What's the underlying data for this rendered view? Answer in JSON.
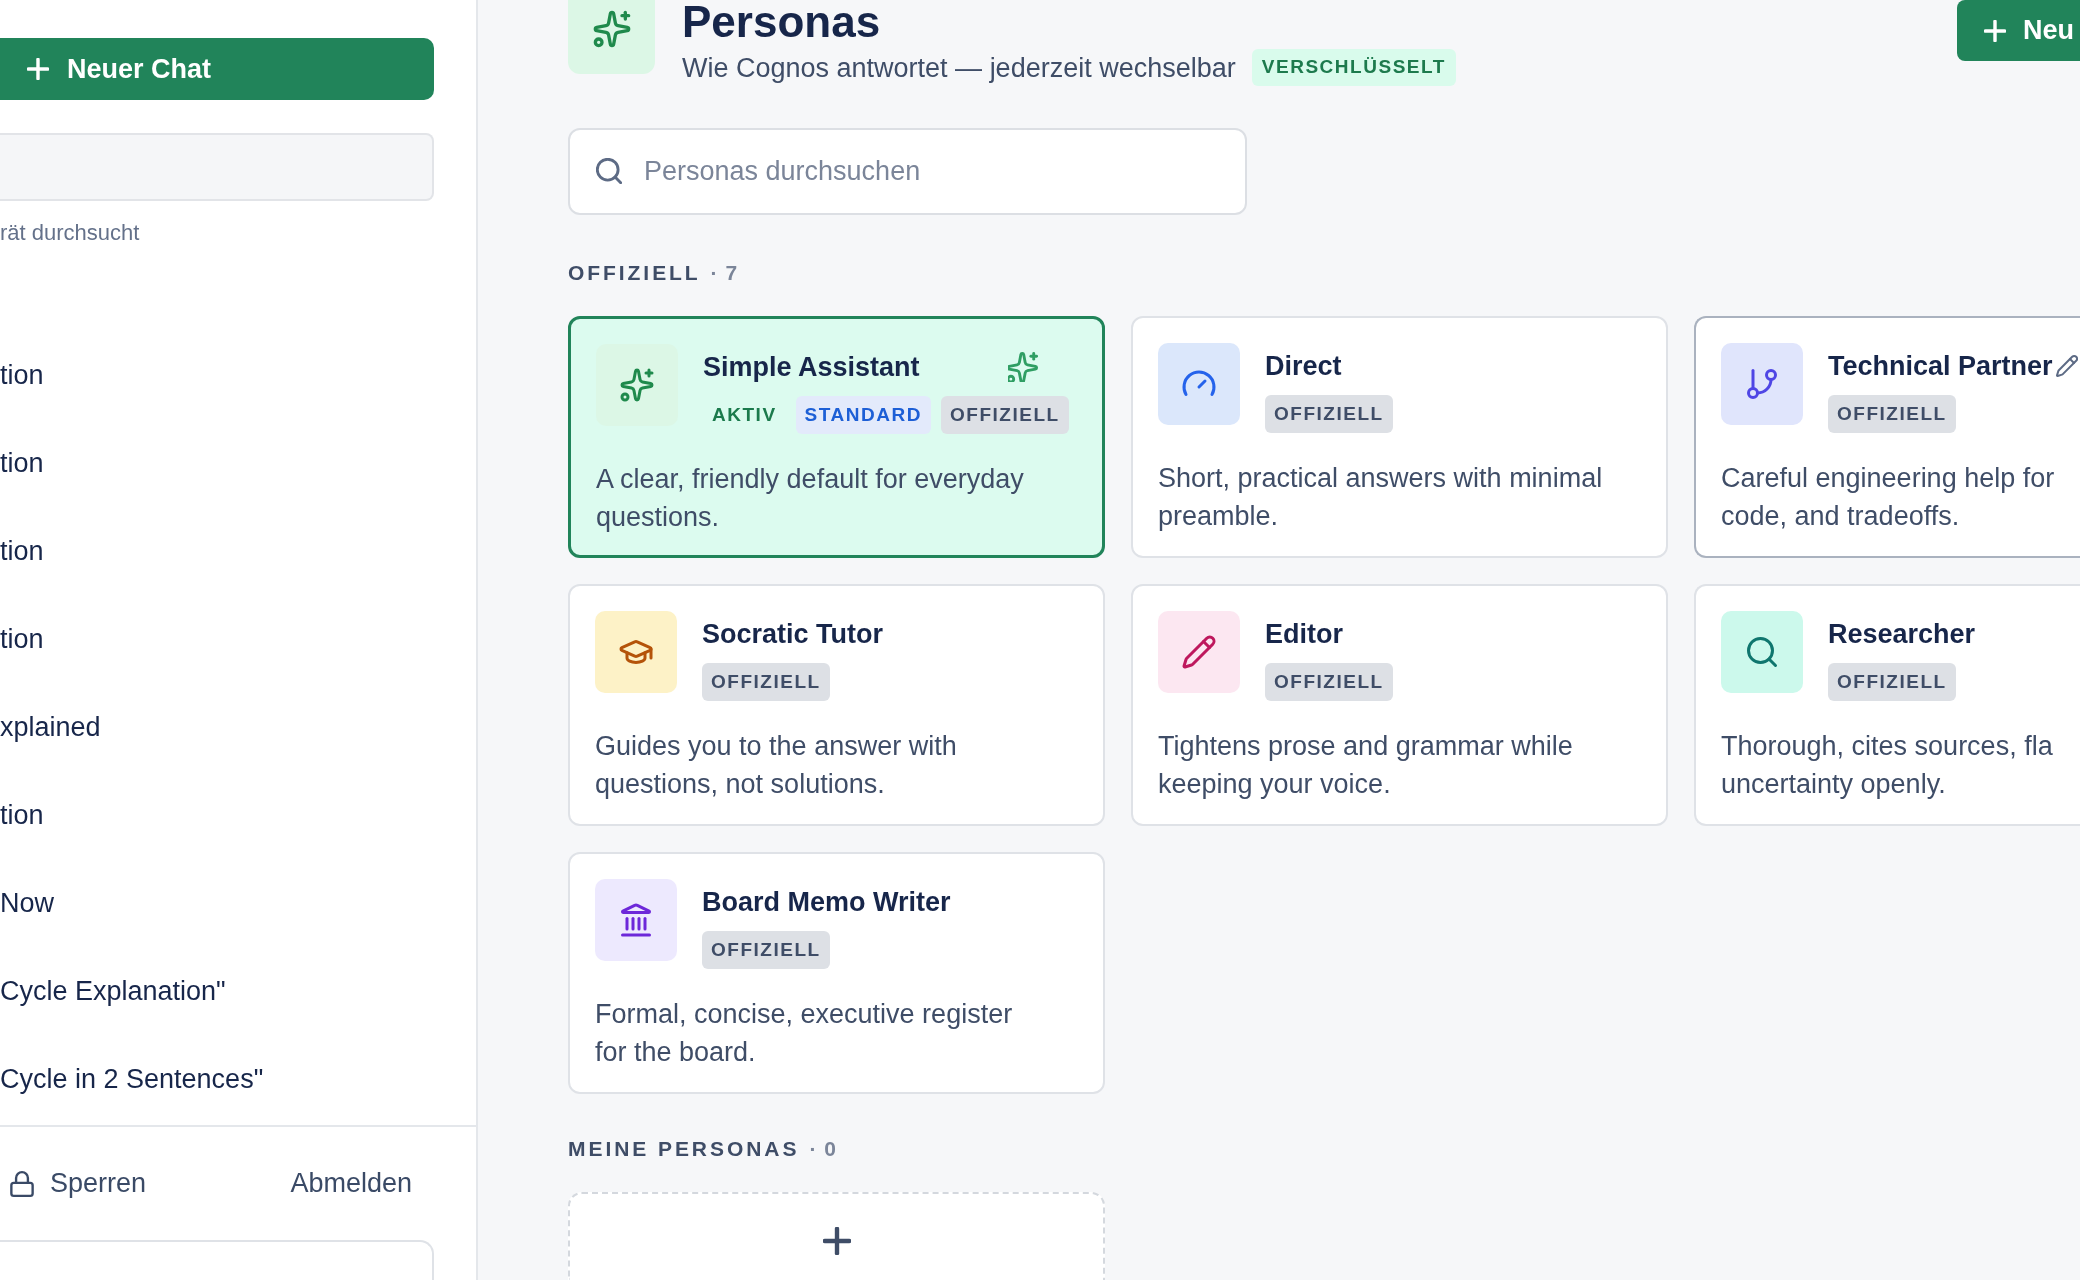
{
  "sidebar": {
    "new_chat": "Neuer Chat",
    "search_hint": "rät durchsucht",
    "chats": [
      "tion",
      "tion",
      "tion",
      "tion",
      "xplained",
      "tion",
      "Now",
      "Cycle Explanation\"",
      "Cycle in 2 Sentences\""
    ],
    "lock_button": "Sperren",
    "logout_button": "Abmelden"
  },
  "header": {
    "title": "Personas",
    "subtitle": "Wie Cognos antwortet — jederzeit wechselbar",
    "badge": "VERSCHLÜSSELT",
    "new_button": "Neu"
  },
  "search": {
    "placeholder": "Personas durchsuchen"
  },
  "official_section": {
    "heading": "OFFIZIELL",
    "count": "· 7"
  },
  "cards": [
    {
      "name": "Simple Assistant",
      "badges": [
        {
          "label": "AKTIV",
          "kind": "active"
        },
        {
          "label": "STANDARD",
          "kind": "standard"
        },
        {
          "label": "OFFIZIELL",
          "kind": "official"
        }
      ],
      "description": "A clear, friendly default for everyday\nquestions.",
      "selected": true,
      "hovered": false
    },
    {
      "name": "Direct",
      "badges": [
        {
          "label": "OFFIZIELL",
          "kind": "official"
        }
      ],
      "description": "Short, practical answers with minimal\npreamble.",
      "selected": false,
      "hovered": false
    },
    {
      "name": "Technical Partner",
      "badges": [
        {
          "label": "OFFIZIELL",
          "kind": "official"
        }
      ],
      "description": "Careful engineering help for\ncode, and tradeoffs.",
      "selected": false,
      "hovered": true
    },
    {
      "name": "Socratic Tutor",
      "badges": [
        {
          "label": "OFFIZIELL",
          "kind": "official"
        }
      ],
      "description": "Guides you to the answer with\nquestions, not solutions.",
      "selected": false,
      "hovered": false
    },
    {
      "name": "Editor",
      "badges": [
        {
          "label": "OFFIZIELL",
          "kind": "official"
        }
      ],
      "description": "Tightens prose and grammar while\nkeeping your voice.",
      "selected": false,
      "hovered": false
    },
    {
      "name": "Researcher",
      "badges": [
        {
          "label": "OFFIZIELL",
          "kind": "official"
        }
      ],
      "description": "Thorough, cites sources, fla\nuncertainty openly.",
      "selected": false,
      "hovered": false
    },
    {
      "name": "Board Memo Writer",
      "badges": [
        {
          "label": "OFFIZIELL",
          "kind": "official"
        }
      ],
      "description": "Formal, concise, executive register\nfor the board.",
      "selected": false,
      "hovered": false
    }
  ],
  "my_section": {
    "heading": "MEINE PERSONAS",
    "count": "· 0"
  }
}
